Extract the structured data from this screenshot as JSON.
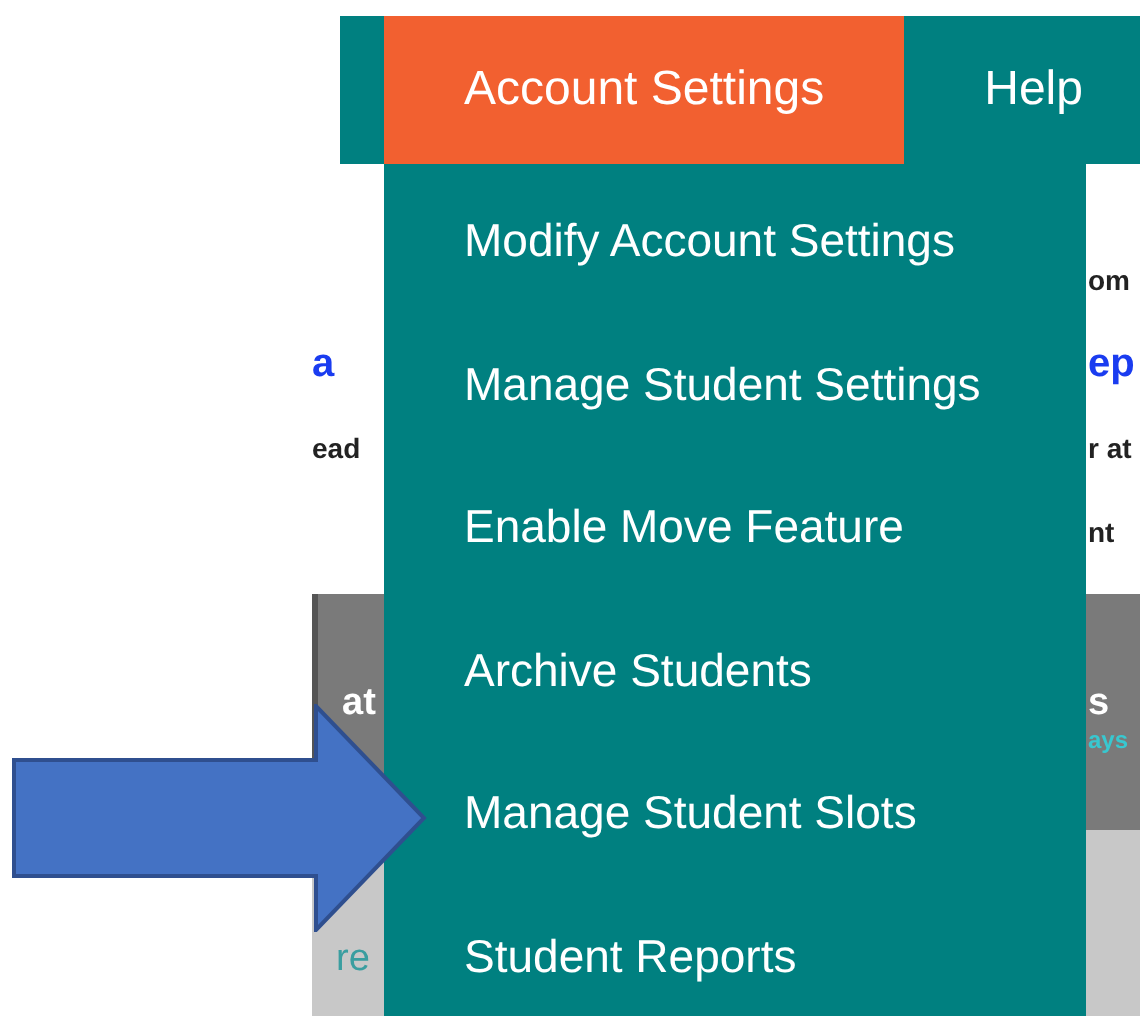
{
  "nav": {
    "tabs": [
      {
        "label": "Account Settings",
        "selected": true
      },
      {
        "label": "Help",
        "selected": false
      }
    ]
  },
  "menu": {
    "items": [
      "Modify Account Settings",
      "Manage Student Settings",
      "Enable Move Feature",
      "Archive Students",
      "Manage Student Slots",
      "Student Reports"
    ]
  },
  "background": {
    "rows": [
      {
        "right": {
          "text": "om",
          "color": "#222222"
        }
      },
      {
        "left": {
          "text": "a",
          "color": "#1a3cf0"
        },
        "right": {
          "text": "ep",
          "color": "#1a3cf0"
        }
      },
      {
        "left": {
          "text": "ead",
          "color": "#222222"
        },
        "right": {
          "text": "r at",
          "color": "#222222"
        }
      },
      {
        "right": {
          "text": "nt",
          "color": "#222222"
        }
      }
    ],
    "header_band": {
      "left": "at",
      "right": "s",
      "sub": "ays"
    },
    "lower_band": {
      "left": "re"
    }
  },
  "pointer_arrow": {
    "kind": "block-arrow"
  }
}
